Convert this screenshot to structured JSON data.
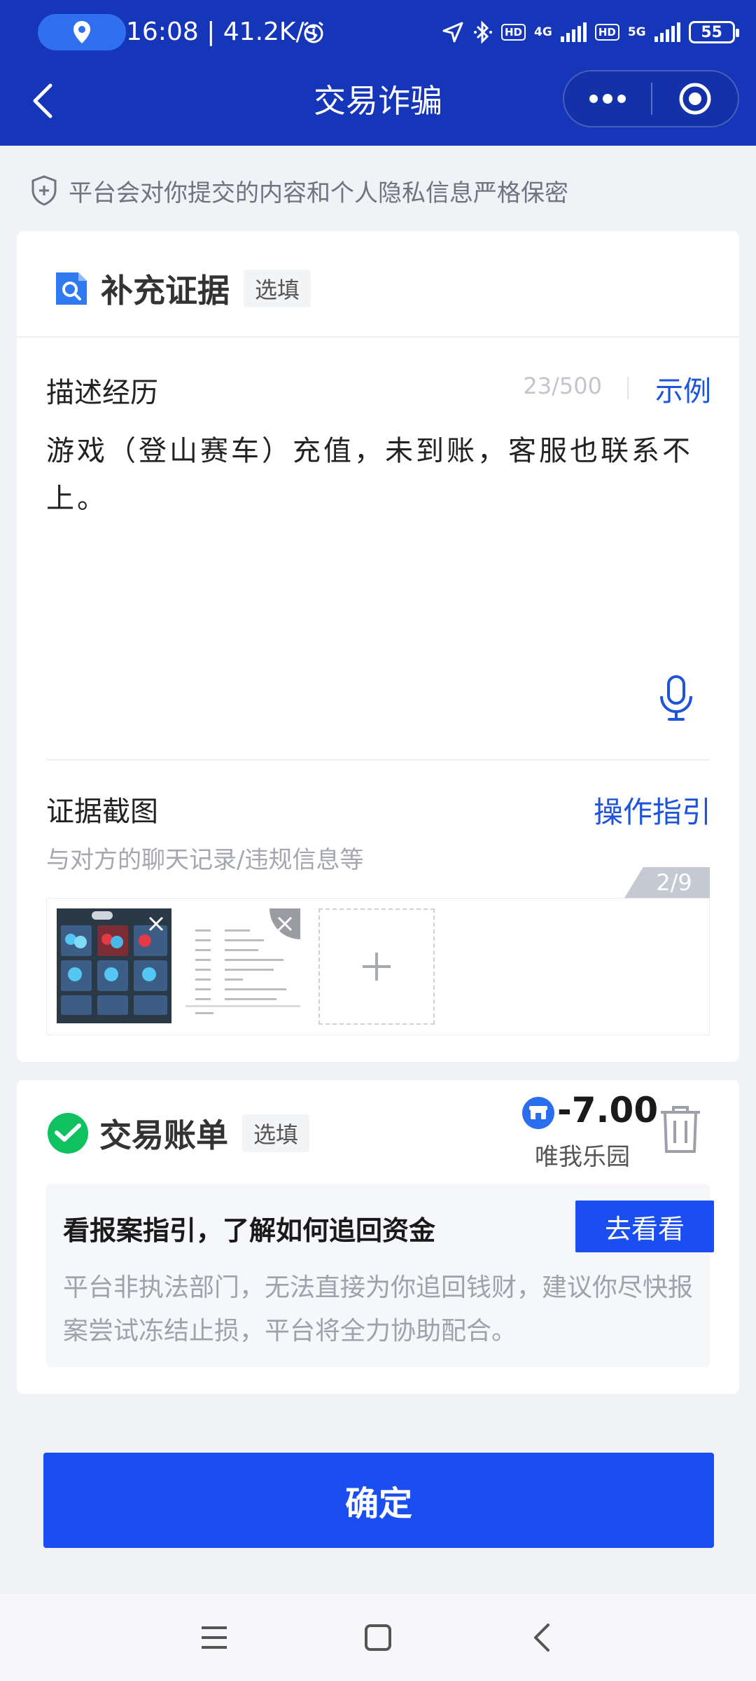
{
  "status_bar": {
    "time_speed": "16:08 | 41.2K/s",
    "net_4g": "4G",
    "net_5g": "5G",
    "hd1": "HD",
    "hd2": "HD",
    "battery": "55"
  },
  "nav": {
    "title": "交易诈骗"
  },
  "privacy_notice": "平台会对你提交的内容和个人隐私信息严格保密",
  "evidence": {
    "title": "补充证据",
    "tag": "选填",
    "description_label": "描述经历",
    "char_count": "23/500",
    "example_link": "示例",
    "description_text": "游戏（登山赛车）充值，未到账，客服也联系不上。",
    "screenshot_label": "证据截图",
    "guide_link": "操作指引",
    "screenshot_hint": "与对方的聊天记录/违规信息等",
    "image_count": "2/9"
  },
  "bill": {
    "title": "交易账单",
    "tag": "选填",
    "amount": "-7.00",
    "merchant": "唯我乐园",
    "guide_title": "看报案指引，了解如何追回资金",
    "guide_button": "去看看",
    "guide_desc": "平台非执法部门，无法直接为你追回钱财，建议你尽快报案尝试冻结止损，平台将全力协助配合。"
  },
  "confirm_button": "确定",
  "colors": {
    "header": "#1536b8",
    "primary": "#1a4ef0",
    "link": "#1d54d9",
    "wechat_green": "#0fc15f"
  }
}
